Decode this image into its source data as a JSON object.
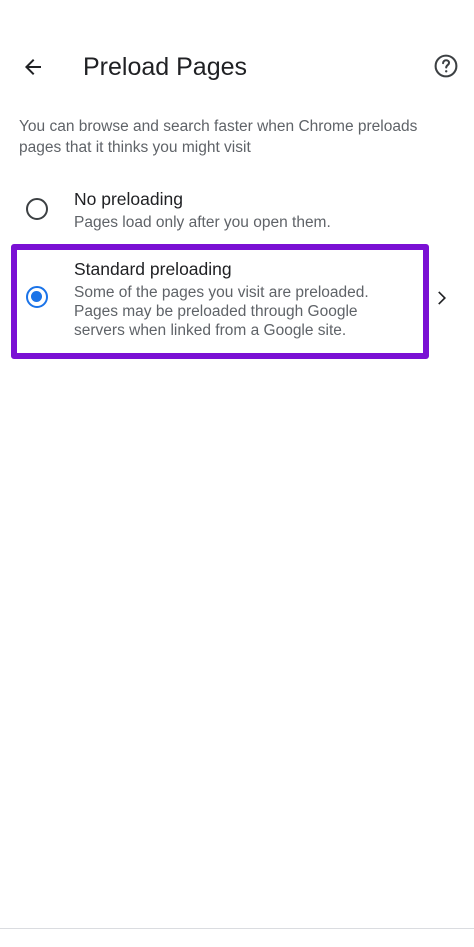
{
  "app_bar": {
    "back_icon": "arrow-left-icon",
    "title": "Preload Pages",
    "help_icon": "help-circle-icon"
  },
  "description": "You can browse and search faster when Chrome preloads pages that it thinks you might visit",
  "options": [
    {
      "title": "No preloading",
      "description": "Pages load only after you open them.",
      "selected": false
    },
    {
      "title": "Standard preloading",
      "description": "Some of the pages you visit are preloaded. Pages may be preloaded through Google servers when linked from a Google site.",
      "selected": true,
      "detail_icon": "chevron-right-icon"
    }
  ],
  "colors": {
    "accent": "#1a73e8",
    "highlight": "#7a10d4",
    "text_primary": "#202124",
    "text_secondary": "#5f6368"
  }
}
